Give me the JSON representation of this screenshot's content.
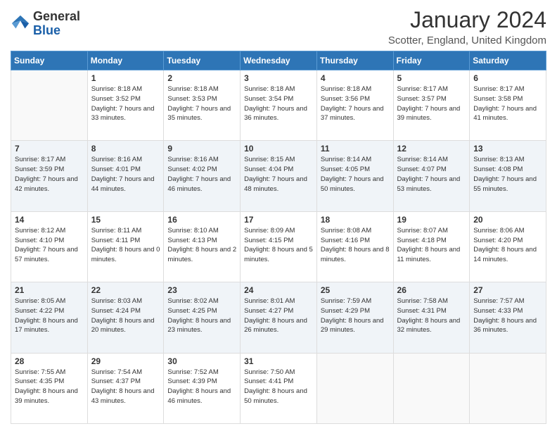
{
  "header": {
    "logo": {
      "general": "General",
      "blue": "Blue"
    },
    "title": "January 2024",
    "location": "Scotter, England, United Kingdom"
  },
  "days_of_week": [
    "Sunday",
    "Monday",
    "Tuesday",
    "Wednesday",
    "Thursday",
    "Friday",
    "Saturday"
  ],
  "weeks": [
    [
      {
        "num": "",
        "empty": true
      },
      {
        "num": "1",
        "sunrise": "Sunrise: 8:18 AM",
        "sunset": "Sunset: 3:52 PM",
        "daylight": "Daylight: 7 hours and 33 minutes."
      },
      {
        "num": "2",
        "sunrise": "Sunrise: 8:18 AM",
        "sunset": "Sunset: 3:53 PM",
        "daylight": "Daylight: 7 hours and 35 minutes."
      },
      {
        "num": "3",
        "sunrise": "Sunrise: 8:18 AM",
        "sunset": "Sunset: 3:54 PM",
        "daylight": "Daylight: 7 hours and 36 minutes."
      },
      {
        "num": "4",
        "sunrise": "Sunrise: 8:18 AM",
        "sunset": "Sunset: 3:56 PM",
        "daylight": "Daylight: 7 hours and 37 minutes."
      },
      {
        "num": "5",
        "sunrise": "Sunrise: 8:17 AM",
        "sunset": "Sunset: 3:57 PM",
        "daylight": "Daylight: 7 hours and 39 minutes."
      },
      {
        "num": "6",
        "sunrise": "Sunrise: 8:17 AM",
        "sunset": "Sunset: 3:58 PM",
        "daylight": "Daylight: 7 hours and 41 minutes."
      }
    ],
    [
      {
        "num": "7",
        "sunrise": "Sunrise: 8:17 AM",
        "sunset": "Sunset: 3:59 PM",
        "daylight": "Daylight: 7 hours and 42 minutes."
      },
      {
        "num": "8",
        "sunrise": "Sunrise: 8:16 AM",
        "sunset": "Sunset: 4:01 PM",
        "daylight": "Daylight: 7 hours and 44 minutes."
      },
      {
        "num": "9",
        "sunrise": "Sunrise: 8:16 AM",
        "sunset": "Sunset: 4:02 PM",
        "daylight": "Daylight: 7 hours and 46 minutes."
      },
      {
        "num": "10",
        "sunrise": "Sunrise: 8:15 AM",
        "sunset": "Sunset: 4:04 PM",
        "daylight": "Daylight: 7 hours and 48 minutes."
      },
      {
        "num": "11",
        "sunrise": "Sunrise: 8:14 AM",
        "sunset": "Sunset: 4:05 PM",
        "daylight": "Daylight: 7 hours and 50 minutes."
      },
      {
        "num": "12",
        "sunrise": "Sunrise: 8:14 AM",
        "sunset": "Sunset: 4:07 PM",
        "daylight": "Daylight: 7 hours and 53 minutes."
      },
      {
        "num": "13",
        "sunrise": "Sunrise: 8:13 AM",
        "sunset": "Sunset: 4:08 PM",
        "daylight": "Daylight: 7 hours and 55 minutes."
      }
    ],
    [
      {
        "num": "14",
        "sunrise": "Sunrise: 8:12 AM",
        "sunset": "Sunset: 4:10 PM",
        "daylight": "Daylight: 7 hours and 57 minutes."
      },
      {
        "num": "15",
        "sunrise": "Sunrise: 8:11 AM",
        "sunset": "Sunset: 4:11 PM",
        "daylight": "Daylight: 8 hours and 0 minutes."
      },
      {
        "num": "16",
        "sunrise": "Sunrise: 8:10 AM",
        "sunset": "Sunset: 4:13 PM",
        "daylight": "Daylight: 8 hours and 2 minutes."
      },
      {
        "num": "17",
        "sunrise": "Sunrise: 8:09 AM",
        "sunset": "Sunset: 4:15 PM",
        "daylight": "Daylight: 8 hours and 5 minutes."
      },
      {
        "num": "18",
        "sunrise": "Sunrise: 8:08 AM",
        "sunset": "Sunset: 4:16 PM",
        "daylight": "Daylight: 8 hours and 8 minutes."
      },
      {
        "num": "19",
        "sunrise": "Sunrise: 8:07 AM",
        "sunset": "Sunset: 4:18 PM",
        "daylight": "Daylight: 8 hours and 11 minutes."
      },
      {
        "num": "20",
        "sunrise": "Sunrise: 8:06 AM",
        "sunset": "Sunset: 4:20 PM",
        "daylight": "Daylight: 8 hours and 14 minutes."
      }
    ],
    [
      {
        "num": "21",
        "sunrise": "Sunrise: 8:05 AM",
        "sunset": "Sunset: 4:22 PM",
        "daylight": "Daylight: 8 hours and 17 minutes."
      },
      {
        "num": "22",
        "sunrise": "Sunrise: 8:03 AM",
        "sunset": "Sunset: 4:24 PM",
        "daylight": "Daylight: 8 hours and 20 minutes."
      },
      {
        "num": "23",
        "sunrise": "Sunrise: 8:02 AM",
        "sunset": "Sunset: 4:25 PM",
        "daylight": "Daylight: 8 hours and 23 minutes."
      },
      {
        "num": "24",
        "sunrise": "Sunrise: 8:01 AM",
        "sunset": "Sunset: 4:27 PM",
        "daylight": "Daylight: 8 hours and 26 minutes."
      },
      {
        "num": "25",
        "sunrise": "Sunrise: 7:59 AM",
        "sunset": "Sunset: 4:29 PM",
        "daylight": "Daylight: 8 hours and 29 minutes."
      },
      {
        "num": "26",
        "sunrise": "Sunrise: 7:58 AM",
        "sunset": "Sunset: 4:31 PM",
        "daylight": "Daylight: 8 hours and 32 minutes."
      },
      {
        "num": "27",
        "sunrise": "Sunrise: 7:57 AM",
        "sunset": "Sunset: 4:33 PM",
        "daylight": "Daylight: 8 hours and 36 minutes."
      }
    ],
    [
      {
        "num": "28",
        "sunrise": "Sunrise: 7:55 AM",
        "sunset": "Sunset: 4:35 PM",
        "daylight": "Daylight: 8 hours and 39 minutes."
      },
      {
        "num": "29",
        "sunrise": "Sunrise: 7:54 AM",
        "sunset": "Sunset: 4:37 PM",
        "daylight": "Daylight: 8 hours and 43 minutes."
      },
      {
        "num": "30",
        "sunrise": "Sunrise: 7:52 AM",
        "sunset": "Sunset: 4:39 PM",
        "daylight": "Daylight: 8 hours and 46 minutes."
      },
      {
        "num": "31",
        "sunrise": "Sunrise: 7:50 AM",
        "sunset": "Sunset: 4:41 PM",
        "daylight": "Daylight: 8 hours and 50 minutes."
      },
      {
        "num": "",
        "empty": true
      },
      {
        "num": "",
        "empty": true
      },
      {
        "num": "",
        "empty": true
      }
    ]
  ]
}
